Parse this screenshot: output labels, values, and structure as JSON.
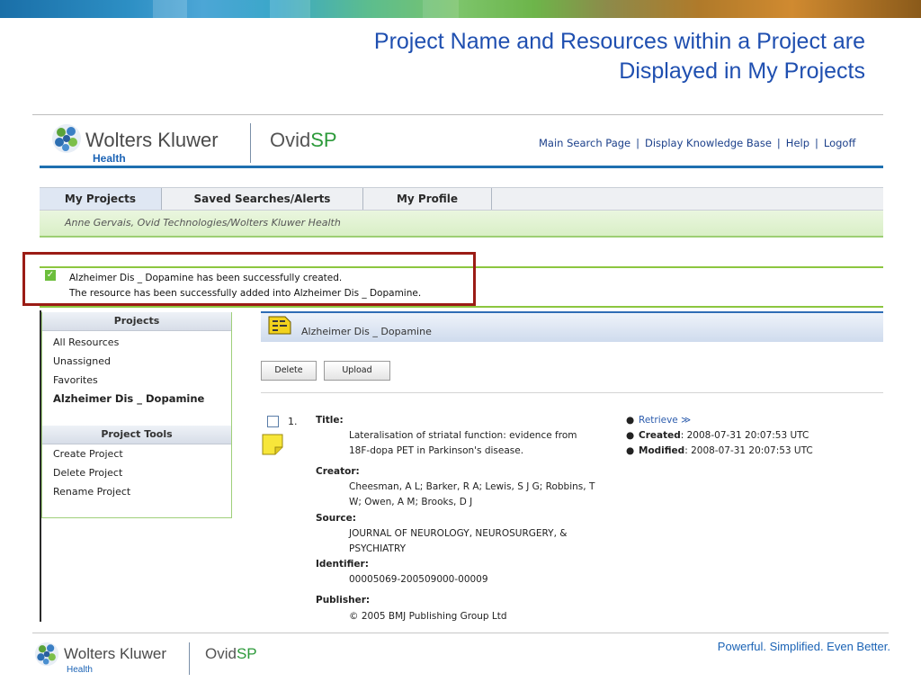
{
  "slide": {
    "title_line1": "Project Name and Resources within a Project are",
    "title_line2": "Displayed in My Projects"
  },
  "header": {
    "logo_text": "Wolters Kluwer",
    "logo_sub": "Health",
    "product_a": "Ovid",
    "product_b": "SP",
    "nav": [
      "Main Search Page",
      "Display Knowledge Base",
      "Help",
      "Logoff"
    ]
  },
  "tabs": [
    "My Projects",
    "Saved Searches/Alerts",
    "My Profile"
  ],
  "user": "Anne Gervais, Ovid Technologies/Wolters Kluwer Health",
  "success": {
    "line1": "Alzheimer Dis _ Dopamine has been successfully created.",
    "line2": "The resource has been successfully added into Alzheimer Dis _ Dopamine."
  },
  "sidebar": {
    "projects_title": "Projects",
    "projects": [
      "All Resources",
      "Unassigned",
      "Favorites",
      "Alzheimer Dis _ Dopamine"
    ],
    "tools_title": "Project Tools",
    "tools": [
      "Create Project",
      "Delete Project",
      "Rename Project"
    ]
  },
  "main": {
    "project_name": "Alzheimer Dis _ Dopamine",
    "buttons": {
      "delete": "Delete",
      "upload": "Upload"
    },
    "record": {
      "number": "1.",
      "title_label": "Title:",
      "title_lines": [
        "Lateralisation of striatal function: evidence from",
        "18F-dopa PET in Parkinson's disease."
      ],
      "creator_label": "Creator:",
      "creator_lines": [
        "Cheesman, A L; Barker, R A; Lewis, S J G; Robbins, T",
        "W; Owen, A M; Brooks, D J"
      ],
      "source_label": "Source:",
      "source_lines": [
        "JOURNAL OF NEUROLOGY, NEUROSURGERY, &",
        "PSYCHIATRY"
      ],
      "identifier_label": "Identifier:",
      "identifier": "00005069-200509000-00009",
      "publisher_label": "Publisher:",
      "publisher": "© 2005 BMJ Publishing Group Ltd",
      "retrieve": "Retrieve ≫",
      "created_label": "Created",
      "created": ": 2008-07-31 20:07:53 UTC",
      "modified_label": "Modified",
      "modified": ": 2008-07-31 20:07:53 UTC"
    }
  },
  "footer": {
    "logo_text": "Wolters Kluwer",
    "logo_sub": "Health",
    "product_a": "Ovid",
    "product_b": "SP",
    "tagline": "Powerful. Simplified. Even Better."
  },
  "colors": {
    "accent_blue": "#1f4fb0",
    "success_green": "#8cc63f",
    "highlight_red": "#9b1c15"
  }
}
